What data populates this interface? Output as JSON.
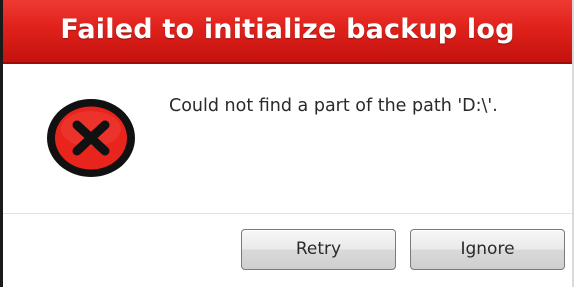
{
  "dialog": {
    "title": "Failed to initialize backup log",
    "message": "Could not find a part of the path 'D:\\'.",
    "icon": "error-icon",
    "buttons": {
      "retry_label": "Retry",
      "ignore_label": "Ignore"
    }
  },
  "colors": {
    "titlebar": "#e0211b",
    "icon_fill": "#e8241c",
    "icon_ring": "#111111"
  }
}
